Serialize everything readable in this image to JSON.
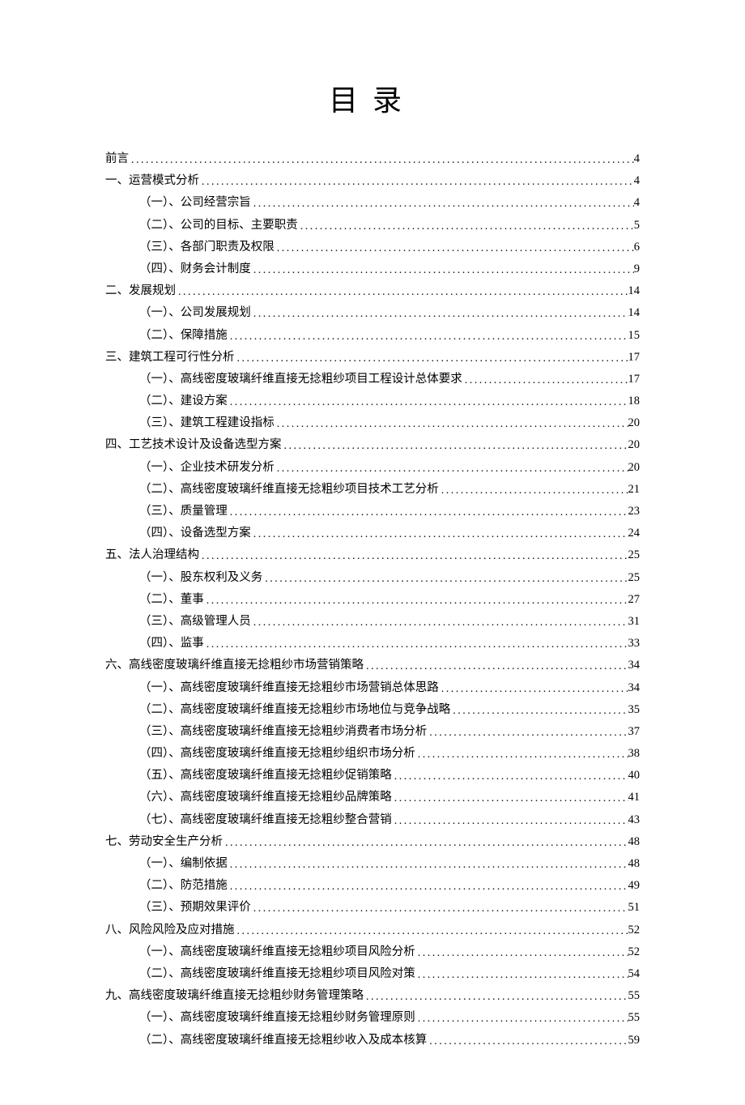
{
  "title": "目录",
  "entries": [
    {
      "level": 0,
      "label": "前言",
      "page": "4"
    },
    {
      "level": 0,
      "label": "一、运营模式分析",
      "page": "4"
    },
    {
      "level": 1,
      "label": "（一）、公司经营宗旨",
      "page": "4"
    },
    {
      "level": 1,
      "label": "（二）、公司的目标、主要职责",
      "page": "5"
    },
    {
      "level": 1,
      "label": "（三）、各部门职责及权限",
      "page": "6"
    },
    {
      "level": 1,
      "label": "（四）、财务会计制度",
      "page": "9"
    },
    {
      "level": 0,
      "label": "二、发展规划",
      "page": "14"
    },
    {
      "level": 1,
      "label": "（一）、公司发展规划",
      "page": "14"
    },
    {
      "level": 1,
      "label": "（二）、保障措施",
      "page": "15"
    },
    {
      "level": 0,
      "label": "三、建筑工程可行性分析",
      "page": "17"
    },
    {
      "level": 1,
      "label": "（一）、高线密度玻璃纤维直接无捻粗纱项目工程设计总体要求",
      "page": "17"
    },
    {
      "level": 1,
      "label": "（二）、建设方案",
      "page": "18"
    },
    {
      "level": 1,
      "label": "（三）、建筑工程建设指标",
      "page": "20"
    },
    {
      "level": 0,
      "label": "四、工艺技术设计及设备选型方案",
      "page": "20"
    },
    {
      "level": 1,
      "label": "（一）、企业技术研发分析",
      "page": "20"
    },
    {
      "level": 1,
      "label": "（二）、高线密度玻璃纤维直接无捻粗纱项目技术工艺分析",
      "page": "21"
    },
    {
      "level": 1,
      "label": "（三）、质量管理",
      "page": "23"
    },
    {
      "level": 1,
      "label": "（四）、设备选型方案",
      "page": "24"
    },
    {
      "level": 0,
      "label": "五、法人治理结构",
      "page": "25"
    },
    {
      "level": 1,
      "label": "（一）、股东权利及义务",
      "page": "25"
    },
    {
      "level": 1,
      "label": "（二）、董事",
      "page": "27"
    },
    {
      "level": 1,
      "label": "（三）、高级管理人员",
      "page": "31"
    },
    {
      "level": 1,
      "label": "（四）、监事",
      "page": "33"
    },
    {
      "level": 0,
      "label": "六、高线密度玻璃纤维直接无捻粗纱市场营销策略",
      "page": "34"
    },
    {
      "level": 1,
      "label": "（一）、高线密度玻璃纤维直接无捻粗纱市场营销总体思路",
      "page": "34"
    },
    {
      "level": 1,
      "label": "（二）、高线密度玻璃纤维直接无捻粗纱市场地位与竞争战略",
      "page": "35"
    },
    {
      "level": 1,
      "label": "（三）、高线密度玻璃纤维直接无捻粗纱消费者市场分析",
      "page": "37"
    },
    {
      "level": 1,
      "label": "（四）、高线密度玻璃纤维直接无捻粗纱组织市场分析",
      "page": "38"
    },
    {
      "level": 1,
      "label": "（五）、高线密度玻璃纤维直接无捻粗纱促销策略",
      "page": "40"
    },
    {
      "level": 1,
      "label": "（六）、高线密度玻璃纤维直接无捻粗纱品牌策略",
      "page": "41"
    },
    {
      "level": 1,
      "label": "（七）、高线密度玻璃纤维直接无捻粗纱整合营销",
      "page": "43"
    },
    {
      "level": 0,
      "label": "七、劳动安全生产分析",
      "page": "48"
    },
    {
      "level": 1,
      "label": "（一）、编制依据",
      "page": "48"
    },
    {
      "level": 1,
      "label": "（二）、防范措施",
      "page": "49"
    },
    {
      "level": 1,
      "label": "（三）、预期效果评价",
      "page": "51"
    },
    {
      "level": 0,
      "label": "八、风险风险及应对措施",
      "page": "52"
    },
    {
      "level": 1,
      "label": "（一）、高线密度玻璃纤维直接无捻粗纱项目风险分析",
      "page": "52"
    },
    {
      "level": 1,
      "label": "（二）、高线密度玻璃纤维直接无捻粗纱项目风险对策",
      "page": "54"
    },
    {
      "level": 0,
      "label": "九、高线密度玻璃纤维直接无捻粗纱财务管理策略",
      "page": "55"
    },
    {
      "level": 1,
      "label": "（一）、高线密度玻璃纤维直接无捻粗纱财务管理原则",
      "page": "55"
    },
    {
      "level": 1,
      "label": "（二）、高线密度玻璃纤维直接无捻粗纱收入及成本核算",
      "page": "59"
    }
  ]
}
